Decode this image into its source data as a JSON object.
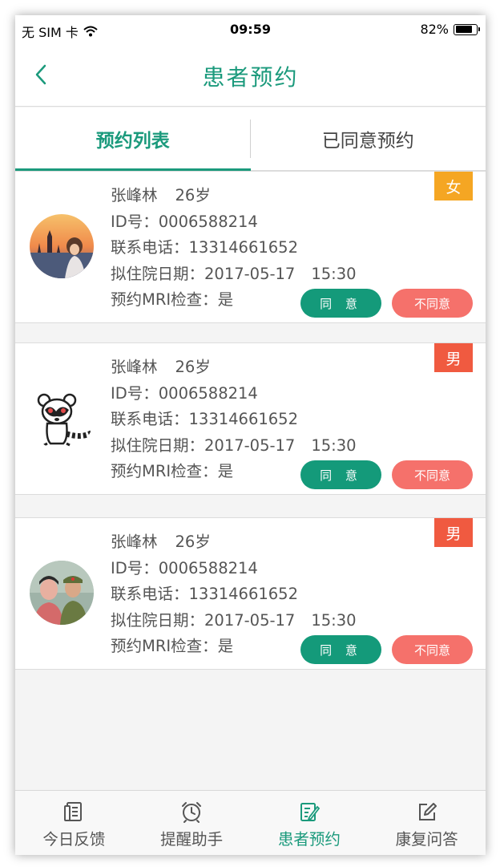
{
  "status_bar": {
    "carrier": "无 SIM 卡",
    "time": "09:59",
    "battery_percent": "82%",
    "battery_level": 0.82
  },
  "nav": {
    "title": "患者预约",
    "back_icon": "chevron-left-icon"
  },
  "tabs": [
    {
      "label": "预约列表",
      "active": true
    },
    {
      "label": "已同意预约",
      "active": false
    }
  ],
  "appointments": [
    {
      "name": "张峰林",
      "age": "26岁",
      "id_line": "ID号：0006588214",
      "phone_line": "联系电话：13314661652",
      "date_line": "拟住院日期：2017-05-17",
      "time": "15:30",
      "mri_line": "预约MRI检查：是",
      "gender": "女",
      "gender_color": "#f5a623",
      "agree_label": "同 意",
      "reject_label": "不同意"
    },
    {
      "name": "张峰林",
      "age": "26岁",
      "id_line": "ID号：0006588214",
      "phone_line": "联系电话：13314661652",
      "date_line": "拟住院日期：2017-05-17",
      "time": "15:30",
      "mri_line": "预约MRI检查：是",
      "gender": "男",
      "gender_color": "#f05a40",
      "agree_label": "同 意",
      "reject_label": "不同意"
    },
    {
      "name": "张峰林",
      "age": "26岁",
      "id_line": "ID号：0006588214",
      "phone_line": "联系电话：13314661652",
      "date_line": "拟住院日期：2017-05-17",
      "time": "15:30",
      "mri_line": "预约MRI检查：是",
      "gender": "男",
      "gender_color": "#f05a40",
      "agree_label": "同 意",
      "reject_label": "不同意"
    }
  ],
  "bottom_tabs": [
    {
      "label": "今日反馈",
      "icon": "document-icon",
      "active": false
    },
    {
      "label": "提醒助手",
      "icon": "alarm-clock-icon",
      "active": false
    },
    {
      "label": "患者预约",
      "icon": "edit-note-icon",
      "active": true
    },
    {
      "label": "康复问答",
      "icon": "pencil-square-icon",
      "active": false
    }
  ],
  "colors": {
    "accent": "#1b9a7c",
    "agree": "#149a7a",
    "reject": "#f5716b",
    "background": "#f4f4f4"
  }
}
